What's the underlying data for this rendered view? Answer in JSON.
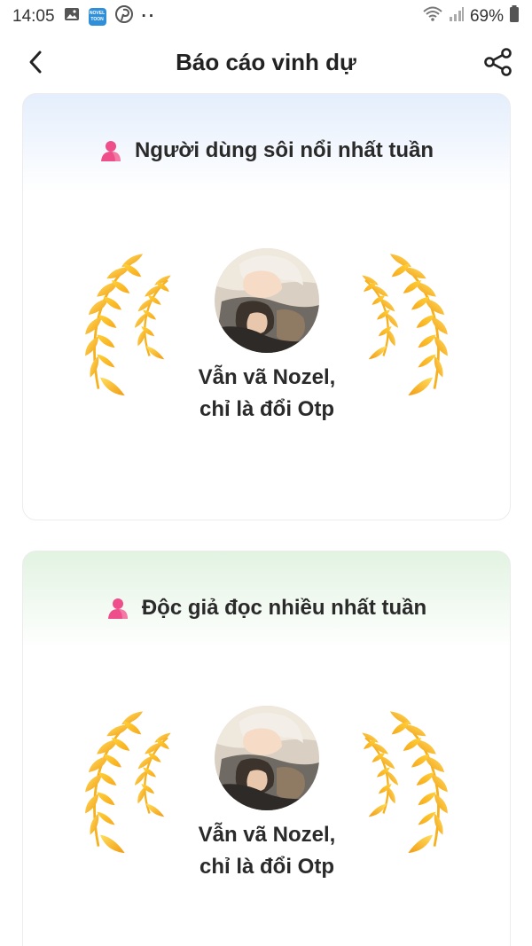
{
  "status_bar": {
    "time": "14:05",
    "app_icon_text": "NOVEL TOON",
    "more_dots": "··",
    "battery": "69%"
  },
  "header": {
    "title": "Báo cáo vinh dự"
  },
  "cards": [
    {
      "title": "Người dùng sôi nổi nhất tuần",
      "user_name_line1": "Vẫn vã Nozel,",
      "user_name_line2": "chỉ là đổi Otp"
    },
    {
      "title": "Độc giả đọc nhiều nhất tuần",
      "user_name_line1": "Vẫn vã Nozel,",
      "user_name_line2": "chỉ là đổi Otp"
    }
  ],
  "icons": {
    "user_icon": "user-icon",
    "back": "back-arrow-icon",
    "share": "share-icon",
    "laurel": "laurel-wreath-icon"
  },
  "colors": {
    "card1_tint": "#e4eefc",
    "card2_tint": "#e2f3e2",
    "user_icon": "#ee4f8a",
    "laurel_light": "#ffd23a",
    "laurel_dark": "#f39a10"
  }
}
